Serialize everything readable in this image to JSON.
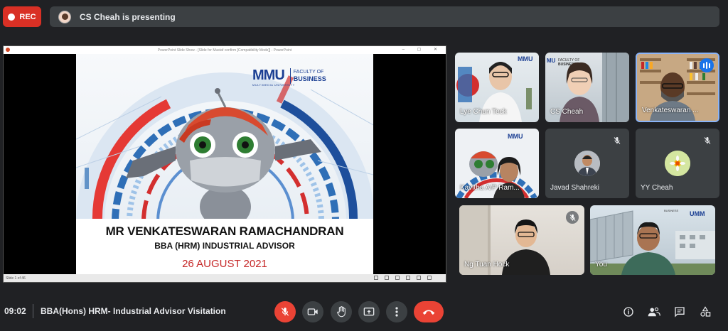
{
  "recording": {
    "label": "REC"
  },
  "presenting": {
    "text": "CS Cheah is presenting"
  },
  "ppt_window": {
    "title": "PowerPoint Slide Show - [Slide for Mustaf confirm [Compatibility Mode]] - PowerPoint",
    "status": "Slide 1 of 46"
  },
  "slide": {
    "logo_text": "MMU",
    "logo_sub": "MULTIMEDIA UNIVERSITY",
    "faculty_line1": "FACULTY OF",
    "faculty_line2": "BUSINESS",
    "name": "MR VENKATESWARAN RAMACHANDRAN",
    "role": "BBA (HRM) INDUSTRIAL ADVISOR",
    "date": "26 AUGUST 2021"
  },
  "participants": [
    {
      "name": "Lye Chun Teck"
    },
    {
      "name": "CS Cheah"
    },
    {
      "name": "Venkateswaran ..."
    },
    {
      "name": "Kavitha A/P Ram..."
    },
    {
      "name": "Javad Shahreki"
    },
    {
      "name": "YY Cheah"
    },
    {
      "name": "Ng Tuan Hock"
    },
    {
      "name": "You"
    }
  ],
  "bottom_bar": {
    "time": "09:02",
    "meeting_title": "BBA(Hons) HRM- Industrial Advisor Visitation"
  },
  "colors": {
    "accent_red": "#ea4335",
    "active_border": "#8ab4f8",
    "brand_blue": "#1b3f93"
  }
}
